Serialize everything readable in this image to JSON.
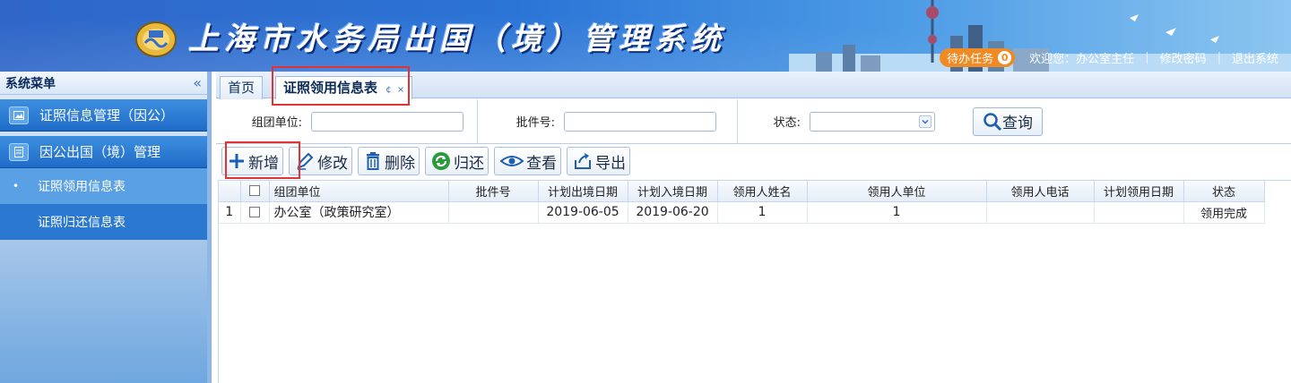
{
  "header": {
    "title": "上海市水务局出国（境）管理系统",
    "tasks_label": "待办任务",
    "tasks_count": "0",
    "welcome": "欢迎您：办公室主任",
    "change_password": "修改密码",
    "logout": "退出系统",
    "separator": "|"
  },
  "sidebar": {
    "title": "系统菜单",
    "collapse_icon": "«",
    "groups": [
      {
        "label": "证照信息管理（因公）"
      },
      {
        "label": "因公出国（境）管理"
      }
    ],
    "items": [
      {
        "label": "证照领用信息表",
        "active": true
      },
      {
        "label": "证照归还信息表",
        "active": false
      }
    ]
  },
  "tabs": [
    {
      "label": "首页"
    },
    {
      "label": "证照领用信息表",
      "refresh": "¢",
      "close": "×"
    }
  ],
  "search": {
    "unit_label": "组团单位:",
    "batch_label": "批件号:",
    "status_label": "状态:",
    "unit_value": "",
    "batch_value": "",
    "status_value": "",
    "search_button": "查询"
  },
  "toolbar": {
    "add": "新增",
    "edit": "修改",
    "delete": "删除",
    "return": "归还",
    "view": "查看",
    "export": "导出"
  },
  "table": {
    "columns": [
      "组团单位",
      "批件号",
      "计划出境日期",
      "计划入境日期",
      "领用人姓名",
      "领用人单位",
      "领用人电话",
      "计划领用日期",
      "状态"
    ],
    "rows": [
      {
        "no": "1",
        "unit": "办公室（政策研究室）",
        "batch": "",
        "exit_date": "2019-06-05",
        "entry_date": "2019-06-20",
        "name": "1",
        "org": "1",
        "phone": "",
        "plan_date": "",
        "status": "领用完成"
      }
    ]
  },
  "colors": {
    "header_blue": "#2a74d6",
    "accent_orange": "#f08a24",
    "highlight_red": "#e23232"
  }
}
